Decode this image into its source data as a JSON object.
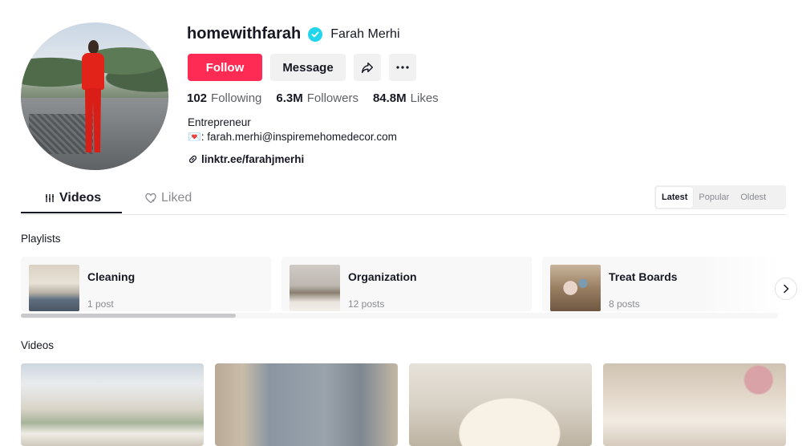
{
  "profile": {
    "username": "homewithfarah",
    "nickname": "Farah Merhi",
    "bio_line1": "Entrepreneur",
    "bio_line2": "💌: farah.merhi@inspiremehomedecor.com",
    "link": "linktr.ee/farahjmerhi"
  },
  "actions": {
    "follow": "Follow",
    "message": "Message"
  },
  "stats": {
    "following_count": "102",
    "following_label": "Following",
    "followers_count": "6.3M",
    "followers_label": "Followers",
    "likes_count": "84.8M",
    "likes_label": "Likes"
  },
  "tabs": {
    "videos": "Videos",
    "liked": "Liked"
  },
  "sort": {
    "options": [
      "Latest",
      "Popular",
      "Oldest"
    ],
    "selected": "Latest"
  },
  "playlists": {
    "title": "Playlists",
    "items": [
      {
        "title": "Cleaning",
        "count": "1 post"
      },
      {
        "title": "Organization",
        "count": "12 posts"
      },
      {
        "title": "Treat Boards",
        "count": "8 posts"
      }
    ]
  },
  "videos_section": {
    "title": "Videos"
  },
  "colors": {
    "accent": "#fe2c55",
    "verified": "#20d5ec"
  },
  "icons": [
    "verified-badge-icon",
    "share-icon",
    "more-icon",
    "link-icon",
    "videos-grid-icon",
    "liked-heart-icon",
    "chevron-right-icon"
  ]
}
